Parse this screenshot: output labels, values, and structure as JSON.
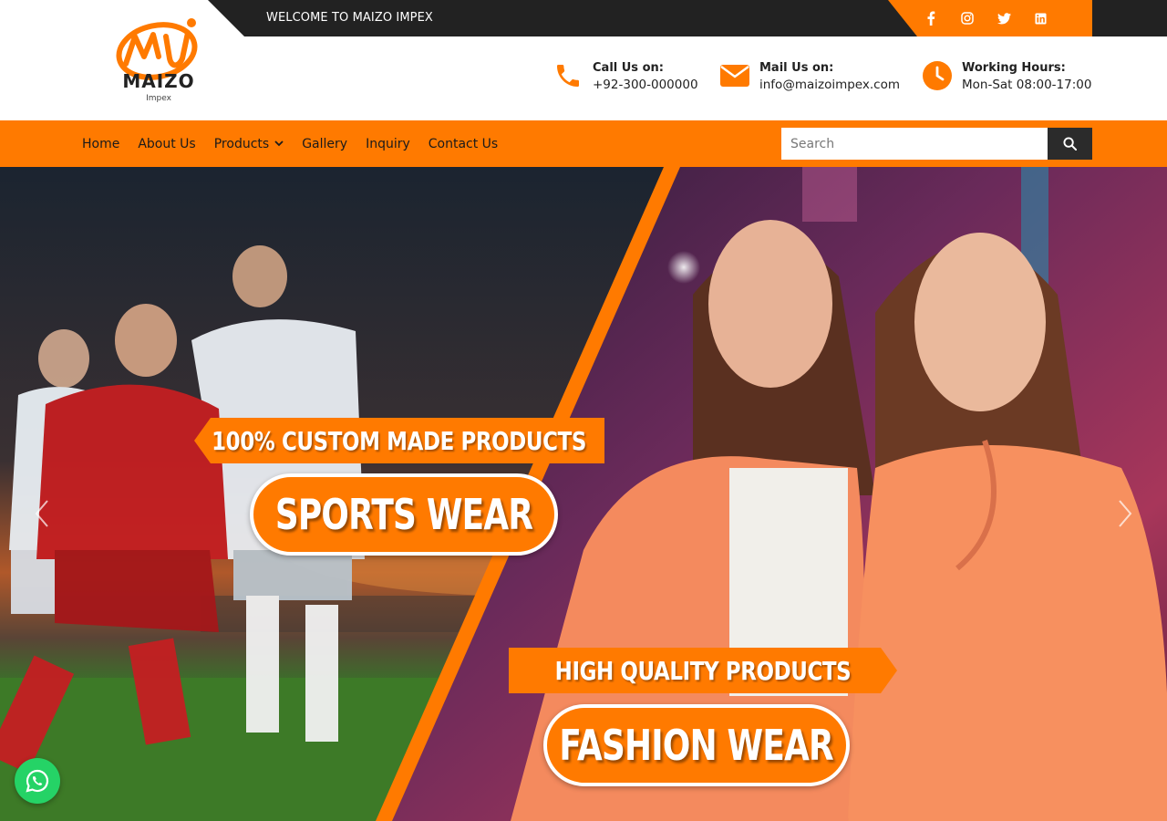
{
  "brand": {
    "name": "MAIZO",
    "sub": "Impex",
    "logo_colors": {
      "orange": "#ff7a00",
      "dark": "#222222"
    }
  },
  "topbar": {
    "welcome": "WELCOME TO MAIZO IMPEX",
    "social_icons": [
      "facebook-icon",
      "instagram-icon",
      "twitter-icon",
      "linkedin-icon"
    ]
  },
  "contact": {
    "phone": {
      "label": "Call Us on:",
      "value": "+92-300-000000",
      "icon": "phone-icon"
    },
    "mail": {
      "label": "Mail Us on:",
      "value": "info@maizoimpex.com",
      "icon": "envelope-icon"
    },
    "hours": {
      "label": "Working Hours:",
      "value": "Mon-Sat 08:00-17:00",
      "icon": "clock-icon"
    }
  },
  "nav": {
    "items": [
      {
        "label": "Home"
      },
      {
        "label": "About Us"
      },
      {
        "label": "Products",
        "has_dropdown": true
      },
      {
        "label": "Gallery"
      },
      {
        "label": "Inquiry"
      },
      {
        "label": "Contact Us"
      }
    ]
  },
  "search": {
    "placeholder": "Search"
  },
  "hero": {
    "left": {
      "tagline": "100% CUSTOM MADE PRODUCTS",
      "title": "SPORTS WEAR"
    },
    "right": {
      "tagline": "HIGH QUALITY PRODUCTS",
      "title": "FASHION WEAR"
    }
  },
  "colors": {
    "accent": "#ff7a00",
    "dark": "#222222",
    "whatsapp": "#25d366"
  }
}
